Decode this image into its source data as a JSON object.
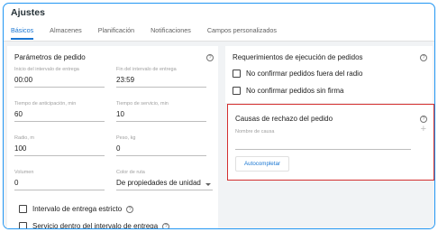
{
  "title": "Ajustes",
  "tabs": [
    {
      "label": "Básicos",
      "active": true
    },
    {
      "label": "Almacenes"
    },
    {
      "label": "Planificación"
    },
    {
      "label": "Notificaciones"
    },
    {
      "label": "Campos personalizados"
    }
  ],
  "order_params": {
    "title": "Parámetros de pedido",
    "fields": {
      "start": {
        "label": "Inicio del intervalo de entrega",
        "value": "00:00"
      },
      "end": {
        "label": "Fin del intervalo de entrega",
        "value": "23:59"
      },
      "advance": {
        "label": "Tiempo de anticipación, min",
        "value": "60"
      },
      "service": {
        "label": "Tiempo de servicio, min",
        "value": "10"
      },
      "radius": {
        "label": "Radio, m",
        "value": "100"
      },
      "weight": {
        "label": "Peso, kg",
        "value": "0"
      },
      "volume": {
        "label": "Volumen",
        "value": "0"
      },
      "route_color": {
        "label": "Color de ruta",
        "value": "De propiedades de unidad"
      }
    },
    "checkboxes": {
      "strict": "Intervalo de entrega estricto",
      "service_within": "Servicio dentro del intervalo de entrega"
    }
  },
  "execution": {
    "title": "Requerimientos de ejecución de pedidos",
    "checkboxes": {
      "no_radius": "No confirmar pedidos fuera del radio",
      "no_signature": "No confirmar pedidos sin firma"
    }
  },
  "rejection": {
    "title": "Causas de rechazo del pedido",
    "cause_label": "Nombre de causa",
    "add_symbol": "+",
    "autocomplete_label": "Autocompletar"
  },
  "help_symbol": "?",
  "colors": {
    "accent": "#1976d2",
    "frame": "#2196f3",
    "highlight": "#d32f2f"
  }
}
